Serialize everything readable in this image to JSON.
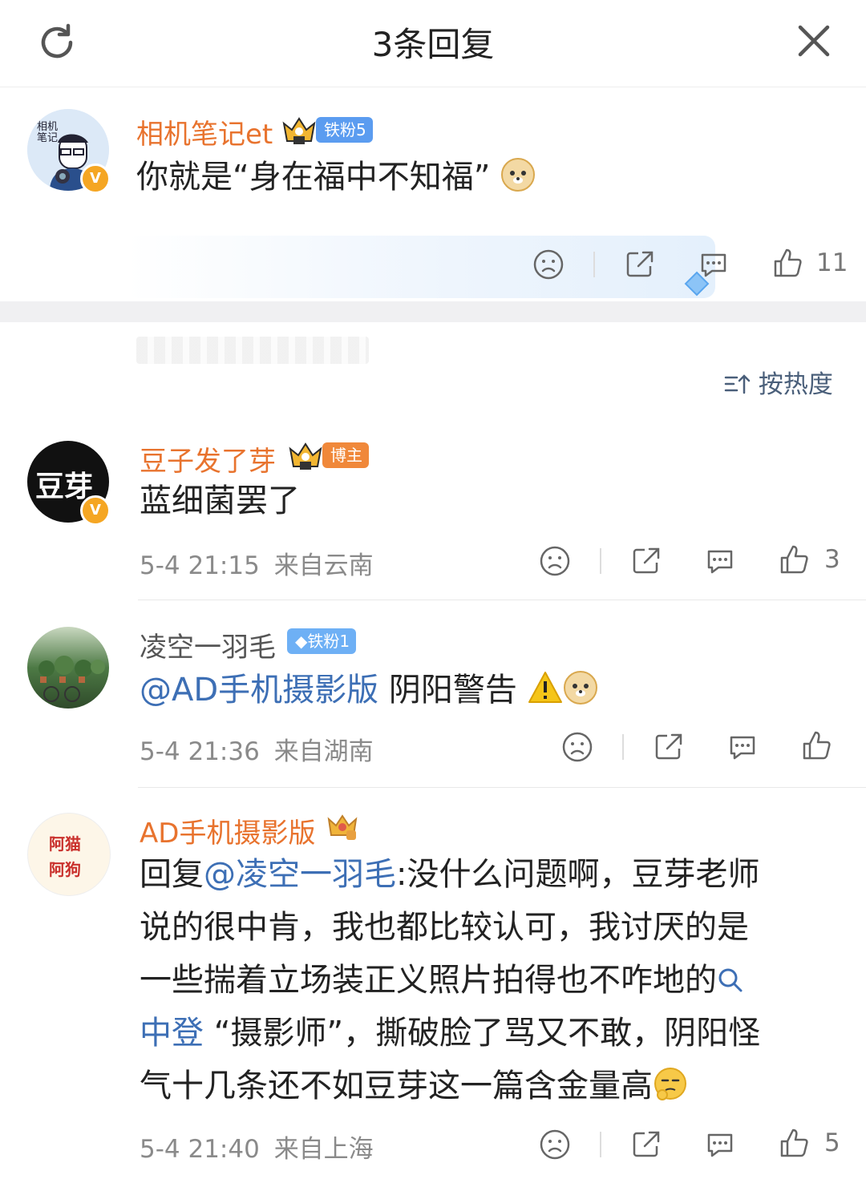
{
  "header": {
    "title": "3条回复"
  },
  "sort_label": "按热度",
  "main_comment": {
    "avatar_text": "相机\n笔记",
    "name": "相机笔记et",
    "tag": "铁粉5",
    "text": "你就是“身在福中不知福”",
    "like_count": "11"
  },
  "replies": [
    {
      "name": "豆子发了芽",
      "avatar_text": "豆芽",
      "tag": "博主",
      "text": "蓝细菌罢了",
      "time": "5-4 21:15",
      "location": "来自云南",
      "like_count": "3"
    },
    {
      "name": "凌空一羽毛",
      "tag": "铁粉1",
      "mention": "@AD手机摄影版",
      "text": " 阴阳警告",
      "time": "5-4 21:36",
      "location": "来自湖南",
      "like_count": ""
    },
    {
      "name": "AD手机摄影版",
      "avatar_text": "阿猫\n阿狗",
      "reply_prefix": "回复",
      "mention": "@凌空一羽毛",
      "line1_rest": ":没什么问题啊，豆芽老师",
      "line2": "说的很中肯，我也都比较认可，我讨厌的是",
      "line3": "一些揣着立场装正义照片拍得也不咋地的",
      "line4_link": "中登",
      "line4_rest": " “摄影师”，撕破脸了骂又不敢，阴阳怪",
      "line5": "气十几条还不如豆芽这一篇含金量高",
      "time": "5-4 21:40",
      "location": "来自上海",
      "like_count": "5"
    }
  ],
  "colors": {
    "name_orange": "#e8732e",
    "link_blue": "#3d6fb5",
    "meta_gray": "#8a8a8a"
  }
}
